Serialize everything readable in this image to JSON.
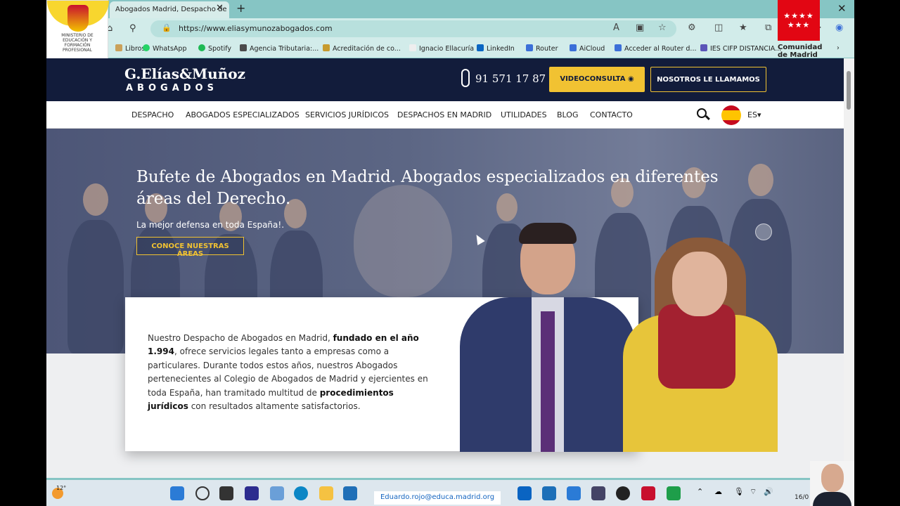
{
  "browser": {
    "tab_title": "Abogados Madrid, Despacho de",
    "url": "https://www.eliasymunozabogados.com"
  },
  "bookmarks": [
    "Libros",
    "WhatsApp",
    "Spotify",
    "Agencia Tributaria:...",
    "Acreditación de co...",
    "Ignacio Ellacuría",
    "LinkedIn",
    "Router",
    "AiCloud",
    "Acceder al Router d...",
    "IES CIFP DISTANCIA..."
  ],
  "overlays": {
    "ministerio": "MINISTERIO DE EDUCACIÓN Y FORMACIÓN PROFESIONAL",
    "comunidad_line1": "Comunidad",
    "comunidad_line2": "de Madrid"
  },
  "site": {
    "logo_name": "G.Elías&Muñoz",
    "logo_sub": "ABOGADOS",
    "phone": "91 571 17 87",
    "video_button": "VIDEOCONSULTA",
    "call_button": "NOSOTROS LE LLAMAMOS",
    "nav": [
      "DESPACHO",
      "ABOGADOS ESPECIALIZADOS",
      "SERVICIOS JURÍDICOS",
      "DESPACHOS EN MADRID",
      "UTILIDADES",
      "BLOG",
      "CONTACTO"
    ],
    "lang": "ES",
    "hero_title": "Bufete de Abogados en Madrid. Abogados especializados en diferentes áreas del Derecho.",
    "hero_subtitle": "La mejor defensa en toda España!.",
    "hero_button": "CONOCE NUESTRAS ÁREAS",
    "card_part1": "Nuestro Despacho de Abogados en Madrid, ",
    "card_bold1": "fundado en el año 1.994",
    "card_part2": ", ofrece servicios legales tanto a empresas como a particulares. Durante todos estos años, nuestros Abogados pertenecientes al Colegio de Abogados de Madrid y ejercientes en toda España, han tramitado multitud de ",
    "card_bold2": "procedimientos jurídicos",
    "card_part3": " con resultados altamente satisfactorios."
  },
  "taskbar": {
    "weather_temp": "12°",
    "email": "Eduardo.rojo@educa.madrid.org",
    "date": "16/0"
  },
  "colors": {
    "navy": "#121c3b",
    "gold": "#f1c232",
    "browser_teal": "#86c5c4"
  }
}
